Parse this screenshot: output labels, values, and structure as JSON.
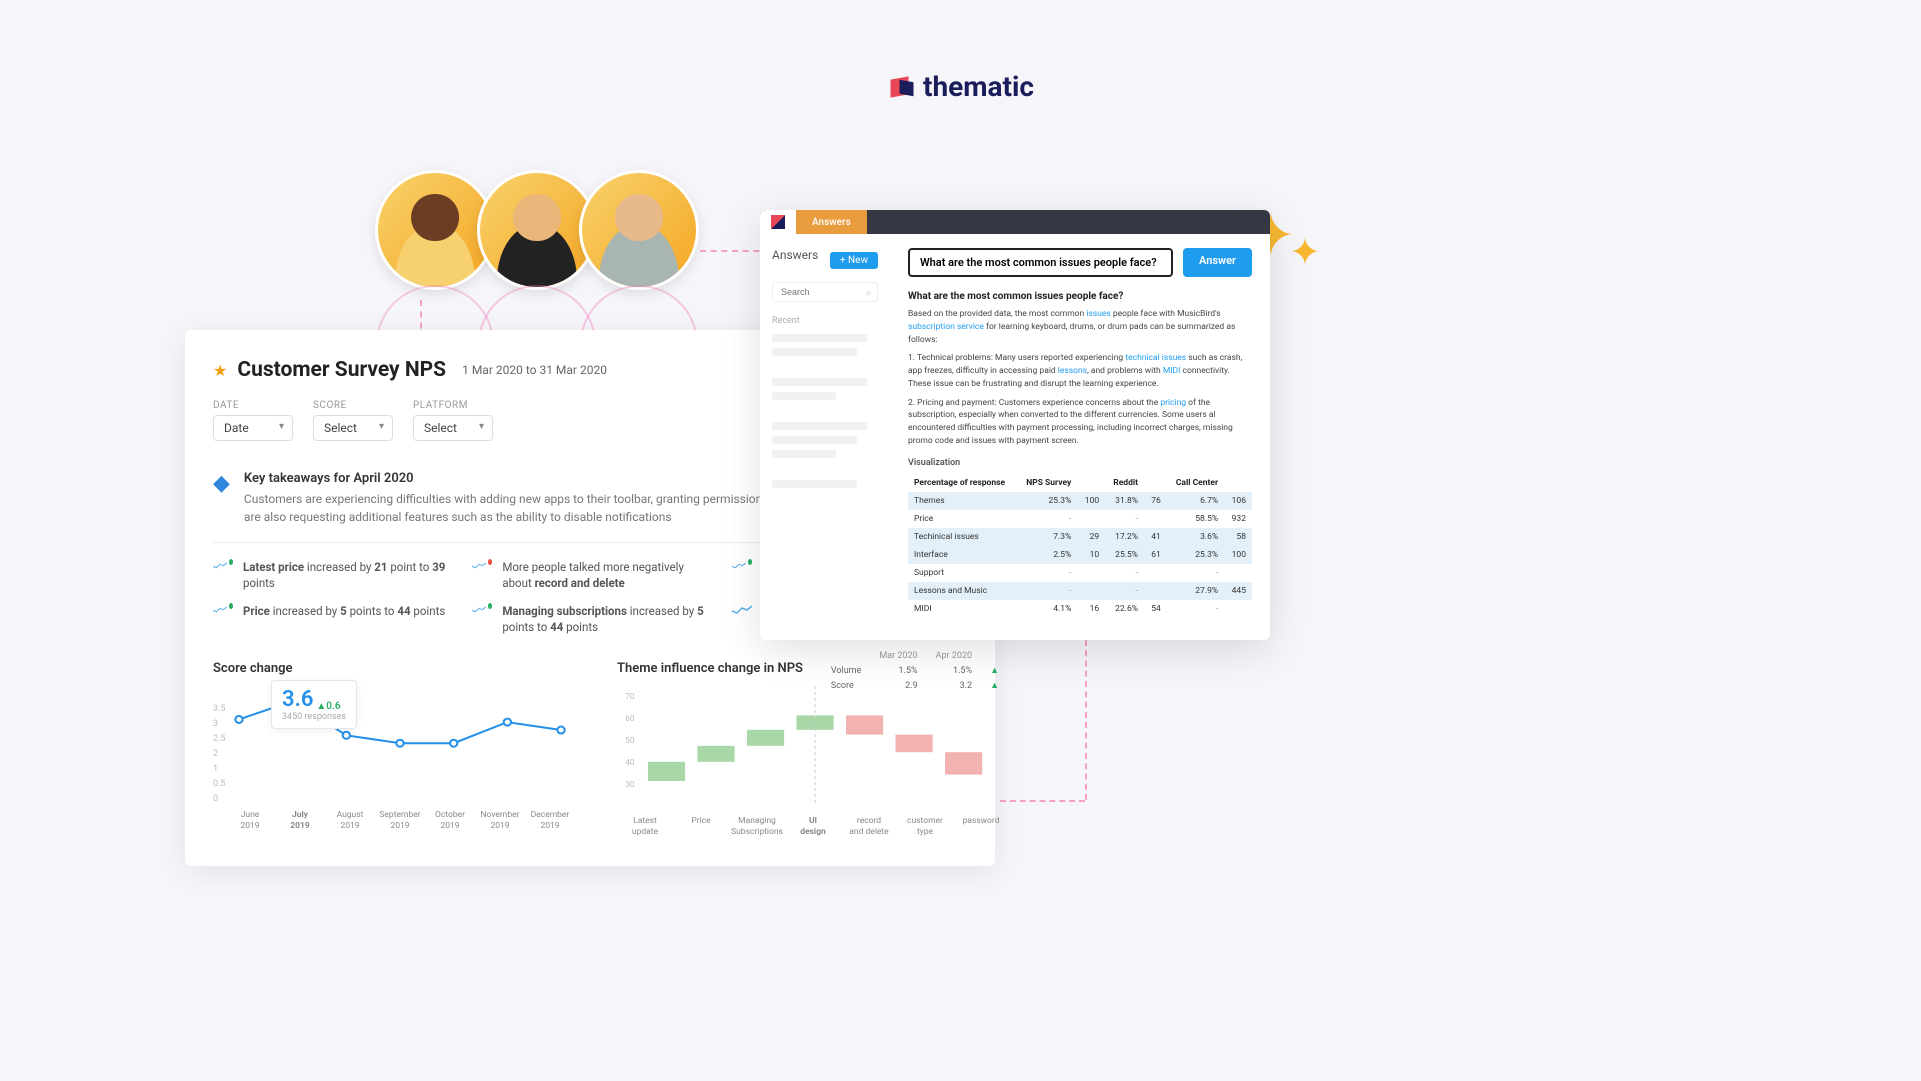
{
  "brand": {
    "name": "thematic"
  },
  "dashboard": {
    "title": "Customer Survey NPS",
    "date_range": "1 Mar 2020 to 31 Mar 2020",
    "filters": {
      "date": {
        "label": "DATE",
        "value": "Date"
      },
      "score": {
        "label": "SCORE",
        "value": "Select"
      },
      "platform": {
        "label": "PLATFORM",
        "value": "Select"
      }
    },
    "takeaway": {
      "title": "Key takeaways for April 2020",
      "body": "Customers are experiencing difficulties with adding new apps to their toolbar, granting permissions to apps, and more. Some customers are also requesting additional features such as the ability to disable notifications"
    },
    "metrics": [
      {
        "html": "<b>Latest price</b> increased by <b>21</b> point to <b>39</b> points",
        "tone": "pos"
      },
      {
        "html": "More people talked more negatively about <b>record and delete</b>",
        "tone": "neg"
      },
      {
        "html": "",
        "tone": "pos"
      },
      {
        "html": "<b>Price</b> increased by <b>5</b> points to <b>44</b> points",
        "tone": "pos"
      },
      {
        "html": "<b>Managing subscriptions</b> increased by <b>5</b> points to <b>44</b> points",
        "tone": "pos"
      },
      {
        "html": "",
        "tone": ""
      }
    ],
    "score_chart": {
      "title": "Score change",
      "tooltip_value": "3.6",
      "tooltip_delta": "0.6",
      "tooltip_responses": "3450 responses"
    },
    "theme_chart": {
      "title": "Theme influence change in NPS",
      "legend": {
        "cols": [
          "Mar 2020",
          "Apr 2020"
        ],
        "rows": [
          {
            "name": "Volume",
            "vals": [
              "1.5%",
              "1.5%"
            ],
            "arrow": "up"
          },
          {
            "name": "Score",
            "vals": [
              "2.9",
              "3.2"
            ],
            "arrow": "up"
          }
        ]
      }
    }
  },
  "chart_data": [
    {
      "type": "line",
      "title": "Score change",
      "categories": [
        "June 2019",
        "July 2019",
        "August 2019",
        "September 2019",
        "October 2019",
        "November 2019",
        "December 2019"
      ],
      "values": [
        2.9,
        3.6,
        2.3,
        2.0,
        2.0,
        2.8,
        2.5
      ],
      "ylim": [
        0,
        3.5
      ],
      "yticks": [
        3.5,
        3.0,
        2.5,
        2.0,
        1.0,
        0.5,
        0
      ]
    },
    {
      "type": "bar",
      "subtype": "waterfall",
      "title": "Theme influence change in NPS",
      "categories": [
        "Latest update",
        "Price",
        "Managing Subscriptions",
        "UI design",
        "record and delete",
        "customer type",
        "password"
      ],
      "series": [
        {
          "name": "influence",
          "values": [
            12,
            10,
            10,
            9,
            -12,
            -11,
            -14
          ],
          "color": [
            "green",
            "green",
            "green",
            "green",
            "red",
            "red",
            "red"
          ]
        }
      ],
      "yticks": [
        70,
        60,
        50,
        40,
        30
      ]
    }
  ],
  "answers": {
    "tab": "Answers",
    "side_title": "Answers",
    "new_btn": "+ New",
    "search_placeholder": "Search",
    "recent_label": "Recent",
    "question": "What are the most common issues people face?",
    "answer_btn": "Answer",
    "viz_label": "Visualization",
    "response": {
      "q": "What are the most common issues people face?",
      "intro_parts": [
        "Based on the provided data, the most common ",
        "issues",
        " people face with MusicBird's ",
        "subscription service",
        " for learning keyboard, drums, or drum pads can be summarized as follows:"
      ],
      "point1_parts": [
        "1. Technical problems: Many users reported experiencing ",
        "technical issues",
        " such as crash, app freezes, difficulty in accessing paid ",
        "lessons",
        ", and problems with ",
        "MIDI",
        " connectivity. These issue can be frustrating and disrupt the learning experience."
      ],
      "point2_parts": [
        "2. Pricing and payment: Customers experience concerns about the ",
        "pricing",
        " of the subscription, especially when converted to the different currencies. Some users al encountered difficulties with payment processing, including incorrect charges, missing promo code and issues with payment screen."
      ]
    },
    "table": {
      "cols": [
        "Percentage of response",
        "NPS Survey",
        "",
        "Reddit",
        "",
        "Call Center",
        ""
      ],
      "rows": [
        {
          "name": "Themes",
          "v": [
            "25.3%",
            "100",
            "31.8%",
            "76",
            "6.7%",
            "106"
          ],
          "alt": true
        },
        {
          "name": "Price",
          "v": [
            "-",
            "",
            "-",
            "",
            "58.5%",
            "932"
          ],
          "alt": false
        },
        {
          "name": "Techinical issues",
          "v": [
            "7.3%",
            "29",
            "17.2%",
            "41",
            "3.6%",
            "58"
          ],
          "alt": true
        },
        {
          "name": "Interface",
          "v": [
            "2.5%",
            "10",
            "25.5%",
            "61",
            "25.3%",
            "100"
          ],
          "alt": true
        },
        {
          "name": "Support",
          "v": [
            "-",
            "",
            "-",
            "",
            "-",
            ""
          ],
          "alt": false
        },
        {
          "name": "Lessons and Music",
          "v": [
            "-",
            "",
            "-",
            "",
            "27.9%",
            "445"
          ],
          "alt": true
        },
        {
          "name": "MIDI",
          "v": [
            "4.1%",
            "16",
            "22.6%",
            "54",
            "-",
            ""
          ],
          "alt": false
        }
      ]
    }
  }
}
